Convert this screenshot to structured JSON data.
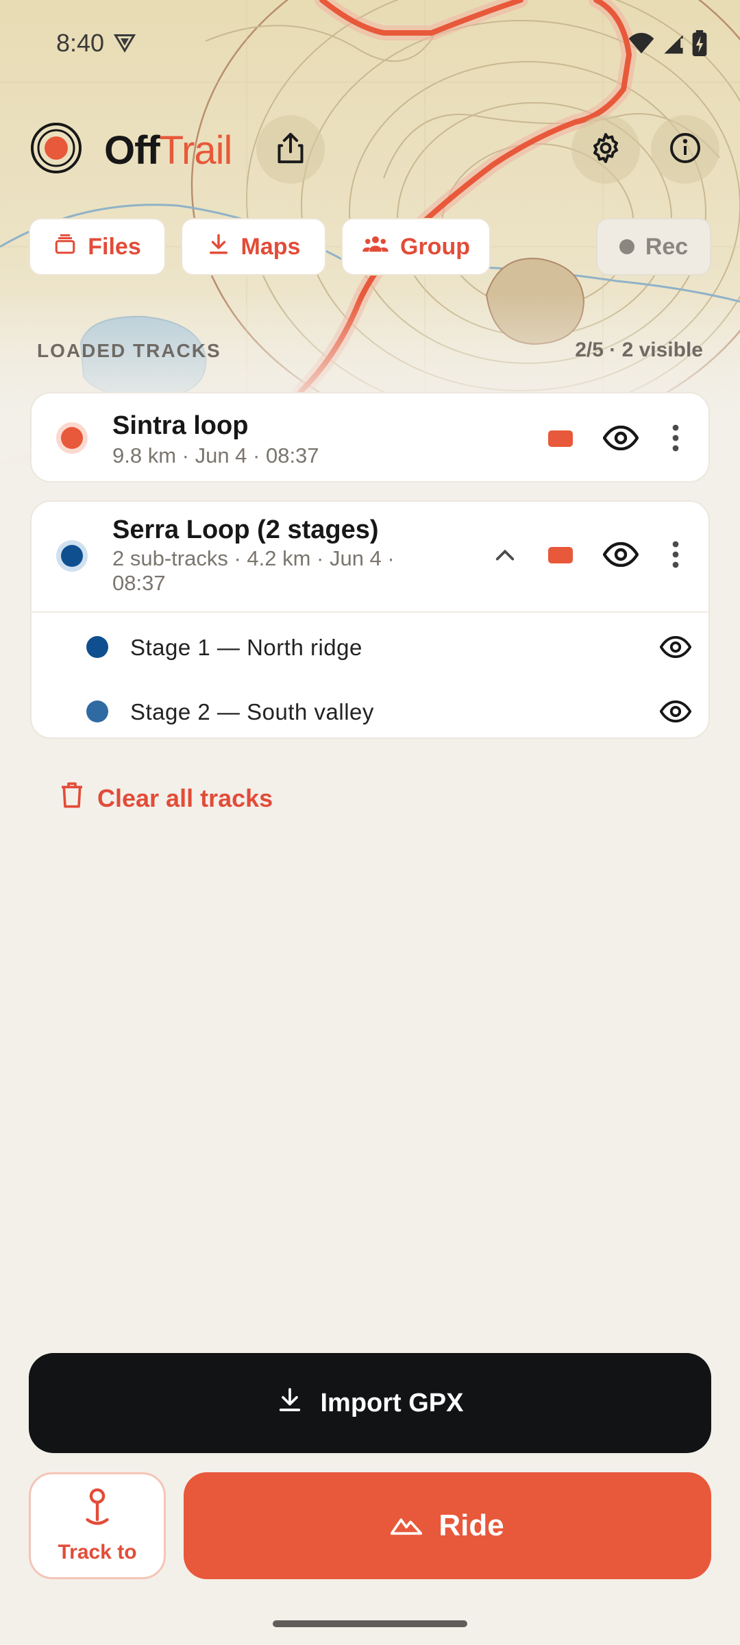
{
  "status_bar": {
    "time": "8:40",
    "icons": [
      "vpn-icon",
      "wifi-icon",
      "signal-icon",
      "battery-charging-icon"
    ]
  },
  "header": {
    "brand_part1": "Off",
    "brand_part2": "Trail",
    "brand_color": "#e8583a",
    "icons": [
      "logo-icon",
      "share-icon",
      "gear-icon",
      "info-icon"
    ]
  },
  "chips": {
    "files": "Files",
    "maps": "Maps",
    "group": "Group",
    "rec": "Rec"
  },
  "loaded_tracks": {
    "title": "LOADED TRACKS",
    "count": "2/5 · 2 visible"
  },
  "tracks": [
    {
      "name": "Sintra loop",
      "meta": "9.8 km · Jun 4 · 08:37",
      "dot_color": "#e8583a"
    },
    {
      "name": "Serra Loop (2 stages)",
      "meta_line1": "2 sub-tracks · 4.2 km · Jun 4 ·",
      "meta_line2": "08:37",
      "dot_color": "#0f4f8f",
      "expanded": true,
      "sub_tracks": [
        {
          "name": "Stage 1 — North ridge",
          "dot_color": "#0f4f8f"
        },
        {
          "name": "Stage 2 — South valley",
          "dot_color": "#2f6aa3"
        }
      ]
    }
  ],
  "clear_all": "Clear all tracks",
  "import_button": "Import GPX",
  "track_to_button": "Track to",
  "ride_button": "Ride",
  "colors": {
    "accent": "#e8583a",
    "dark_button": "#111315",
    "background": "#f3f0ea"
  }
}
